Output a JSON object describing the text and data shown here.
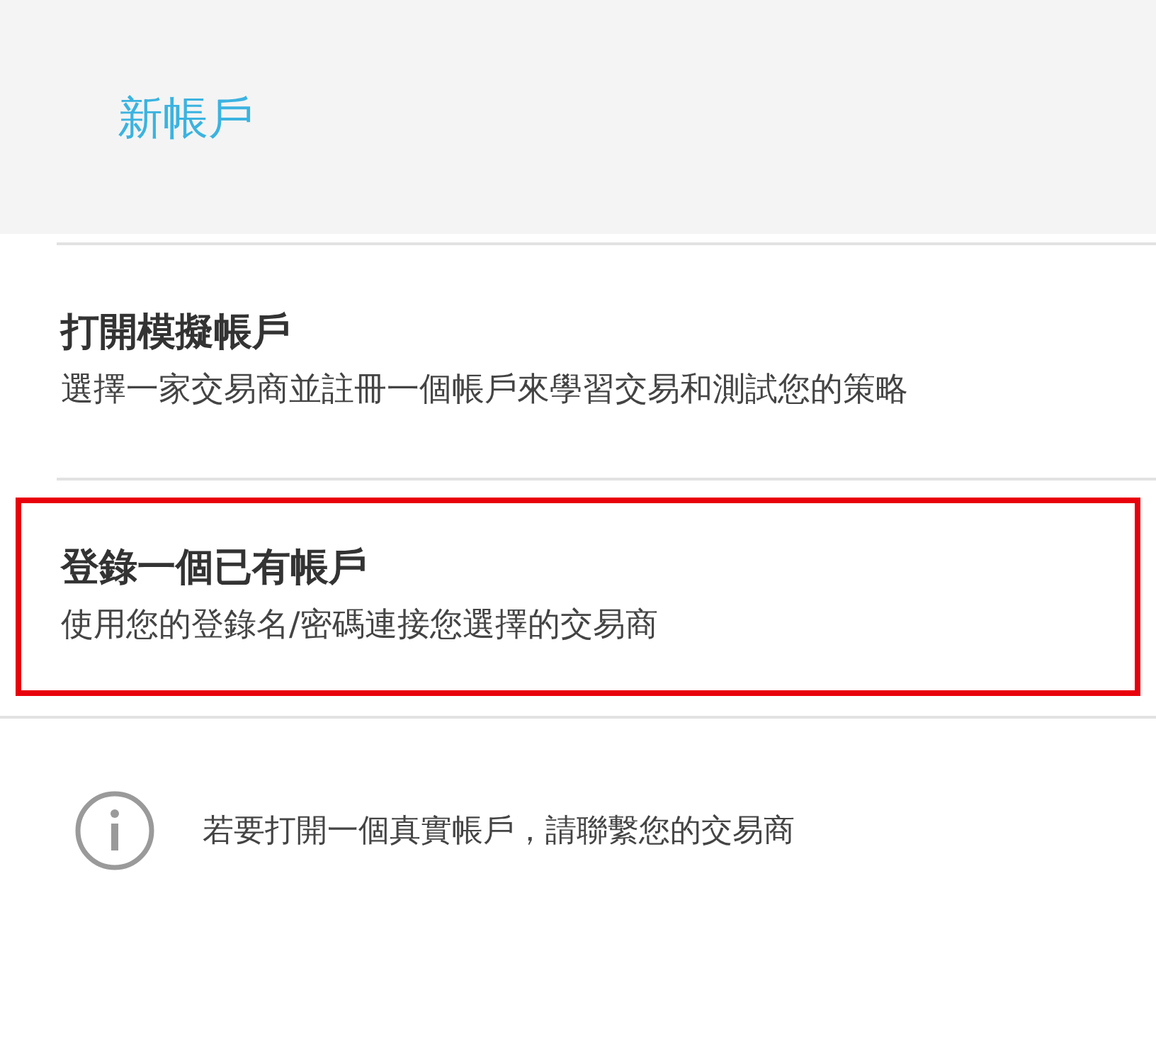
{
  "header": {
    "title": "新帳戶"
  },
  "options": [
    {
      "title": "打開模擬帳戶",
      "description": "選擇一家交易商並註冊一個帳戶來學習交易和測試您的策略",
      "selected": false
    },
    {
      "title": "登錄一個已有帳戶",
      "description": "使用您的登錄名/密碼連接您選擇的交易商",
      "selected": true
    }
  ],
  "info": {
    "text": "若要打開一個真實帳戶，請聯繫您的交易商"
  }
}
